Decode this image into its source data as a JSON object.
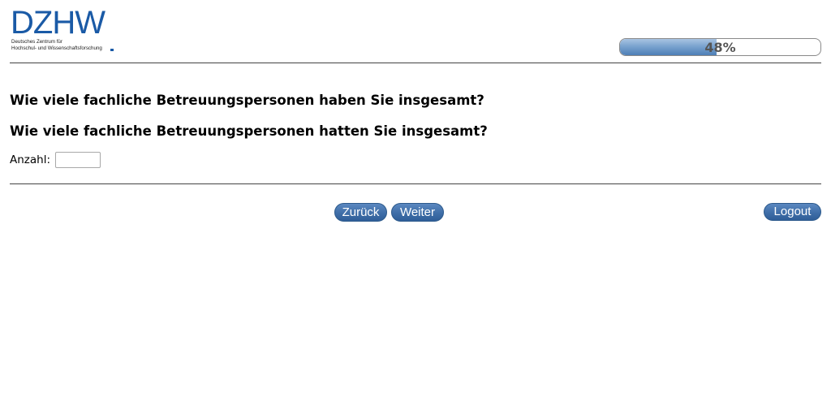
{
  "logo": {
    "mark": "DZHW",
    "line1": "Deutsches Zentrum für",
    "line2": "Hochschul- und Wissenschaftsforschung"
  },
  "progress": {
    "percent_label": "48%",
    "value": 0.48
  },
  "questions": {
    "q1": "Wie viele fachliche Betreuungspersonen haben Sie insgesamt?",
    "q2": "Wie viele fachliche Betreuungspersonen hatten Sie insgesamt?"
  },
  "answer": {
    "label": "Anzahl:",
    "value": ""
  },
  "buttons": {
    "back": "Zurück",
    "next": "Weiter",
    "logout": "Logout"
  },
  "colors": {
    "brand": "#1a5aa6",
    "button": "#3f6ea8"
  }
}
